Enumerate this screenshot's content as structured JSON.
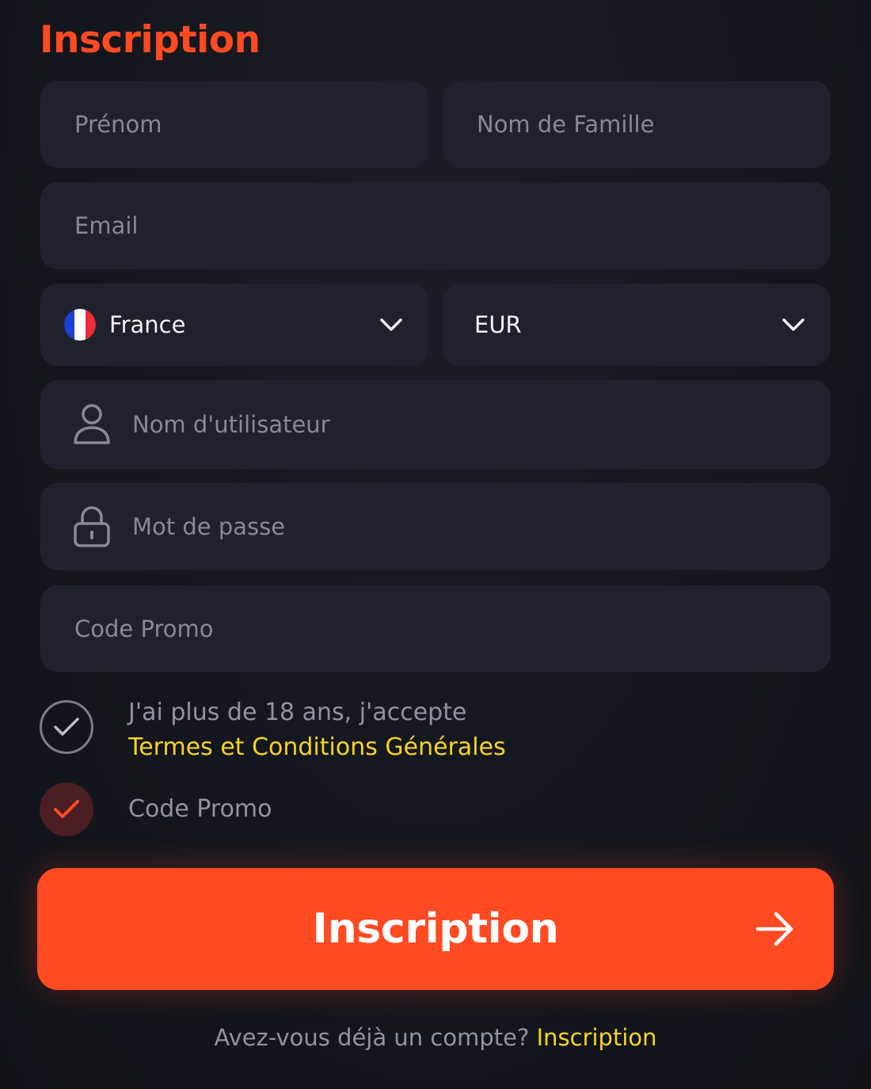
{
  "header": {
    "title": "Inscription"
  },
  "form": {
    "first_name": {
      "placeholder": "Prénom",
      "value": ""
    },
    "last_name": {
      "placeholder": "Nom de Famille",
      "value": ""
    },
    "email": {
      "placeholder": "Email",
      "value": ""
    },
    "country": {
      "selected": "France",
      "icon": "france-flag-icon"
    },
    "currency": {
      "selected": "EUR"
    },
    "username": {
      "placeholder": "Nom d'utilisateur",
      "value": "",
      "icon": "user-icon"
    },
    "password": {
      "placeholder": "Mot de passe",
      "value": "",
      "icon": "lock-icon"
    },
    "promo": {
      "placeholder": "Code Promo",
      "value": ""
    }
  },
  "checks": {
    "terms": {
      "text": "J'ai plus de 18 ans, j'accepte",
      "link": "Termes et Conditions Générales",
      "checked": true
    },
    "promo": {
      "label": "Code Promo",
      "checked": true
    }
  },
  "submit": {
    "label": "Inscription"
  },
  "footer": {
    "text": "Avez-vous déjà un compte? ",
    "link": "Inscription"
  },
  "colors": {
    "accent": "#ff4a22",
    "link": "#f5d428",
    "background": "#14161d",
    "field": "#1f222d",
    "placeholder": "#858a99",
    "flag_blue": "#1d3fd1",
    "flag_white": "#ffffff",
    "flag_red": "#ee2b3a"
  }
}
